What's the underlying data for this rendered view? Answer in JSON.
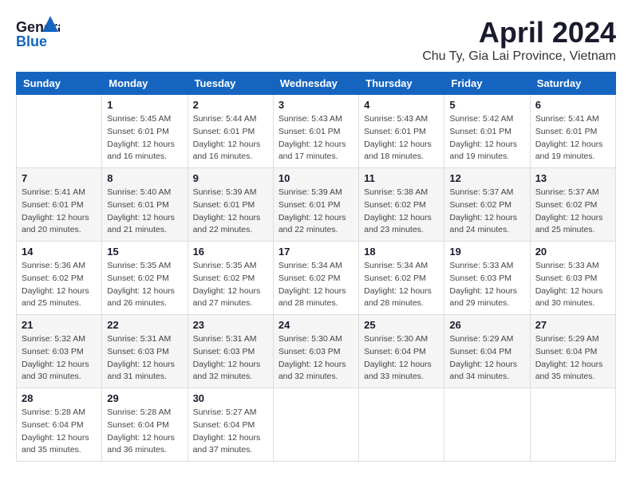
{
  "header": {
    "logo_line1": "General",
    "logo_line2": "Blue",
    "month_title": "April 2024",
    "subtitle": "Chu Ty, Gia Lai Province, Vietnam"
  },
  "weekdays": [
    "Sunday",
    "Monday",
    "Tuesday",
    "Wednesday",
    "Thursday",
    "Friday",
    "Saturday"
  ],
  "weeks": [
    [
      {
        "day": "",
        "info": ""
      },
      {
        "day": "1",
        "info": "Sunrise: 5:45 AM\nSunset: 6:01 PM\nDaylight: 12 hours\nand 16 minutes."
      },
      {
        "day": "2",
        "info": "Sunrise: 5:44 AM\nSunset: 6:01 PM\nDaylight: 12 hours\nand 16 minutes."
      },
      {
        "day": "3",
        "info": "Sunrise: 5:43 AM\nSunset: 6:01 PM\nDaylight: 12 hours\nand 17 minutes."
      },
      {
        "day": "4",
        "info": "Sunrise: 5:43 AM\nSunset: 6:01 PM\nDaylight: 12 hours\nand 18 minutes."
      },
      {
        "day": "5",
        "info": "Sunrise: 5:42 AM\nSunset: 6:01 PM\nDaylight: 12 hours\nand 19 minutes."
      },
      {
        "day": "6",
        "info": "Sunrise: 5:41 AM\nSunset: 6:01 PM\nDaylight: 12 hours\nand 19 minutes."
      }
    ],
    [
      {
        "day": "7",
        "info": "Sunrise: 5:41 AM\nSunset: 6:01 PM\nDaylight: 12 hours\nand 20 minutes."
      },
      {
        "day": "8",
        "info": "Sunrise: 5:40 AM\nSunset: 6:01 PM\nDaylight: 12 hours\nand 21 minutes."
      },
      {
        "day": "9",
        "info": "Sunrise: 5:39 AM\nSunset: 6:01 PM\nDaylight: 12 hours\nand 22 minutes."
      },
      {
        "day": "10",
        "info": "Sunrise: 5:39 AM\nSunset: 6:01 PM\nDaylight: 12 hours\nand 22 minutes."
      },
      {
        "day": "11",
        "info": "Sunrise: 5:38 AM\nSunset: 6:02 PM\nDaylight: 12 hours\nand 23 minutes."
      },
      {
        "day": "12",
        "info": "Sunrise: 5:37 AM\nSunset: 6:02 PM\nDaylight: 12 hours\nand 24 minutes."
      },
      {
        "day": "13",
        "info": "Sunrise: 5:37 AM\nSunset: 6:02 PM\nDaylight: 12 hours\nand 25 minutes."
      }
    ],
    [
      {
        "day": "14",
        "info": "Sunrise: 5:36 AM\nSunset: 6:02 PM\nDaylight: 12 hours\nand 25 minutes."
      },
      {
        "day": "15",
        "info": "Sunrise: 5:35 AM\nSunset: 6:02 PM\nDaylight: 12 hours\nand 26 minutes."
      },
      {
        "day": "16",
        "info": "Sunrise: 5:35 AM\nSunset: 6:02 PM\nDaylight: 12 hours\nand 27 minutes."
      },
      {
        "day": "17",
        "info": "Sunrise: 5:34 AM\nSunset: 6:02 PM\nDaylight: 12 hours\nand 28 minutes."
      },
      {
        "day": "18",
        "info": "Sunrise: 5:34 AM\nSunset: 6:02 PM\nDaylight: 12 hours\nand 28 minutes."
      },
      {
        "day": "19",
        "info": "Sunrise: 5:33 AM\nSunset: 6:03 PM\nDaylight: 12 hours\nand 29 minutes."
      },
      {
        "day": "20",
        "info": "Sunrise: 5:33 AM\nSunset: 6:03 PM\nDaylight: 12 hours\nand 30 minutes."
      }
    ],
    [
      {
        "day": "21",
        "info": "Sunrise: 5:32 AM\nSunset: 6:03 PM\nDaylight: 12 hours\nand 30 minutes."
      },
      {
        "day": "22",
        "info": "Sunrise: 5:31 AM\nSunset: 6:03 PM\nDaylight: 12 hours\nand 31 minutes."
      },
      {
        "day": "23",
        "info": "Sunrise: 5:31 AM\nSunset: 6:03 PM\nDaylight: 12 hours\nand 32 minutes."
      },
      {
        "day": "24",
        "info": "Sunrise: 5:30 AM\nSunset: 6:03 PM\nDaylight: 12 hours\nand 32 minutes."
      },
      {
        "day": "25",
        "info": "Sunrise: 5:30 AM\nSunset: 6:04 PM\nDaylight: 12 hours\nand 33 minutes."
      },
      {
        "day": "26",
        "info": "Sunrise: 5:29 AM\nSunset: 6:04 PM\nDaylight: 12 hours\nand 34 minutes."
      },
      {
        "day": "27",
        "info": "Sunrise: 5:29 AM\nSunset: 6:04 PM\nDaylight: 12 hours\nand 35 minutes."
      }
    ],
    [
      {
        "day": "28",
        "info": "Sunrise: 5:28 AM\nSunset: 6:04 PM\nDaylight: 12 hours\nand 35 minutes."
      },
      {
        "day": "29",
        "info": "Sunrise: 5:28 AM\nSunset: 6:04 PM\nDaylight: 12 hours\nand 36 minutes."
      },
      {
        "day": "30",
        "info": "Sunrise: 5:27 AM\nSunset: 6:04 PM\nDaylight: 12 hours\nand 37 minutes."
      },
      {
        "day": "",
        "info": ""
      },
      {
        "day": "",
        "info": ""
      },
      {
        "day": "",
        "info": ""
      },
      {
        "day": "",
        "info": ""
      }
    ]
  ]
}
